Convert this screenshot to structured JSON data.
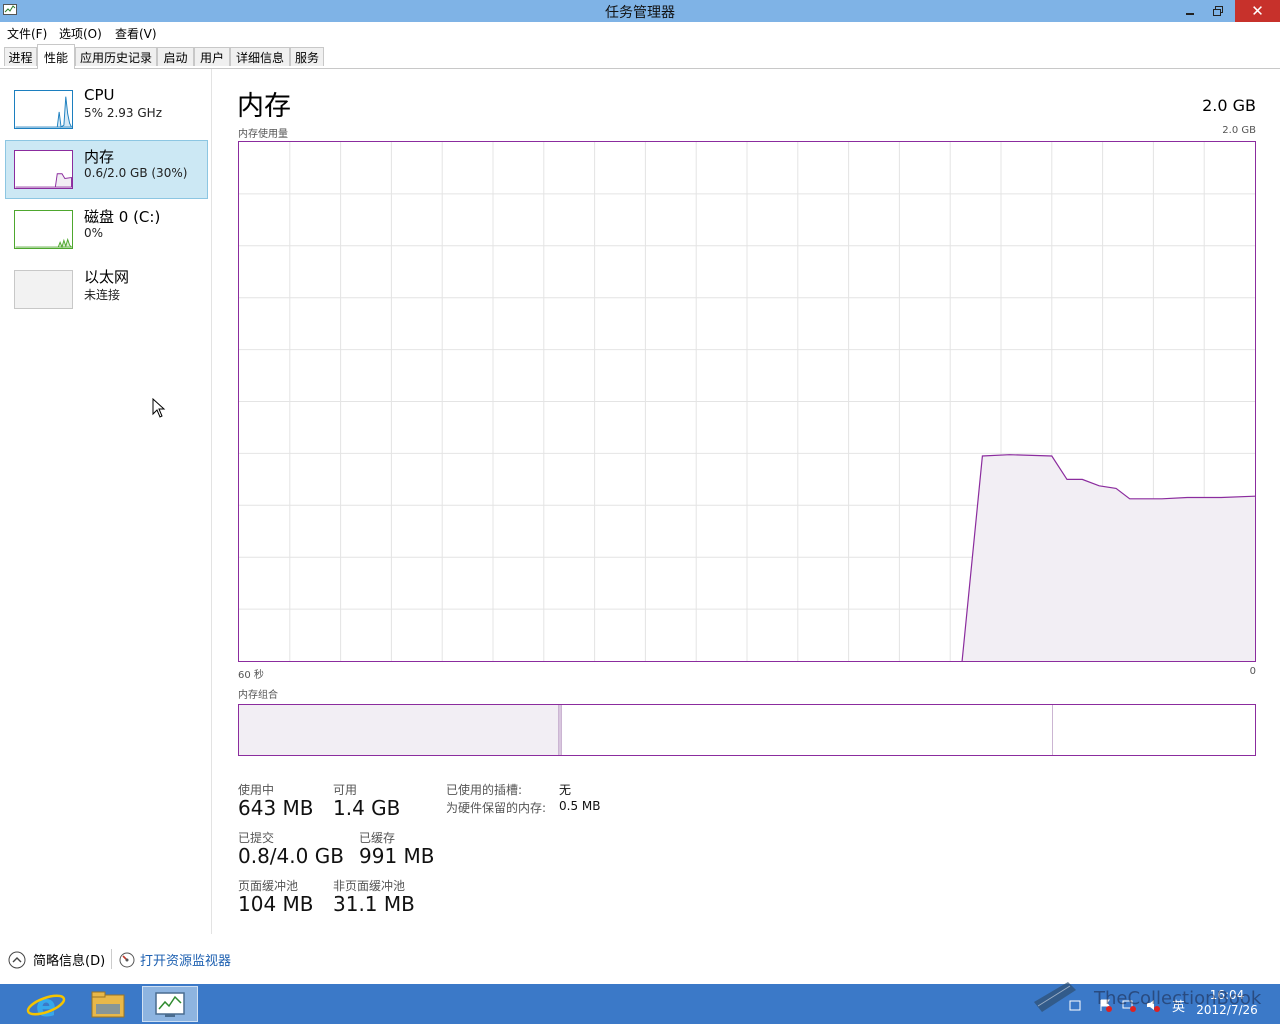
{
  "window": {
    "title": "任务管理器"
  },
  "menu": [
    "文件(F)",
    "选项(O)",
    "查看(V)"
  ],
  "tabs": [
    "进程",
    "性能",
    "应用历史记录",
    "启动",
    "用户",
    "详细信息",
    "服务"
  ],
  "active_tab": "性能",
  "resources": [
    {
      "name": "CPU",
      "sub": "5%  2.93 GHz",
      "color": "#1c7fbf"
    },
    {
      "name": "内存",
      "sub": "0.6/2.0 GB (30%)",
      "color": "#8b2c9e"
    },
    {
      "name": "磁盘 0 (C:)",
      "sub": "0%",
      "color": "#4ea72e"
    },
    {
      "name": "以太网",
      "sub": "未连接",
      "color": "#a0a0a0"
    }
  ],
  "main": {
    "title": "内存",
    "total": "2.0 GB",
    "graph_label": "内存使用量",
    "graph_max": "2.0 GB",
    "x_left": "60 秒",
    "x_right": "0",
    "composition_label": "内存组合"
  },
  "chart_data": {
    "type": "area",
    "title": "内存使用量",
    "xlabel": "",
    "ylabel": "",
    "x_unit": "seconds ago",
    "xlim": [
      60,
      0
    ],
    "ylim": [
      0,
      2.0
    ],
    "y_unit": "GB",
    "grid": true,
    "color": "#8b2c9e",
    "fill": "#f2eef4",
    "points": [
      [
        17.3,
        0.0
      ],
      [
        16.1,
        0.79
      ],
      [
        14.5,
        0.795
      ],
      [
        12.0,
        0.79
      ],
      [
        11.1,
        0.7
      ],
      [
        10.2,
        0.7
      ],
      [
        9.2,
        0.675
      ],
      [
        8.2,
        0.665
      ],
      [
        7.4,
        0.625
      ],
      [
        5.5,
        0.625
      ],
      [
        4.0,
        0.63
      ],
      [
        2.0,
        0.63
      ],
      [
        0,
        0.635
      ]
    ]
  },
  "composition": {
    "segments": [
      {
        "value": 0.63,
        "fill": "#f2eef4"
      },
      {
        "value": 0.005,
        "fill": "#d9c6df"
      },
      {
        "value": 0.97,
        "fill": "#ffffff"
      },
      {
        "value": 0.4,
        "fill": "#ffffff"
      }
    ],
    "color": "#8b2c9e"
  },
  "stats": {
    "in_use_label": "使用中",
    "in_use": "643 MB",
    "available_label": "可用",
    "available": "1.4 GB",
    "committed_label": "已提交",
    "committed": "0.8/4.0 GB",
    "cached_label": "已缓存",
    "cached": "991 MB",
    "paged_label": "页面缓冲池",
    "paged": "104 MB",
    "nonpaged_label": "非页面缓冲池",
    "nonpaged": "31.1 MB",
    "slots_label": "已使用的插槽:",
    "slots": "无",
    "reserved_label": "为硬件保留的内存:",
    "reserved": "0.5 MB"
  },
  "bottom": {
    "fewer_details": "简略信息(D)",
    "open_monitor": "打开资源监视器"
  },
  "taskbar": {
    "time": "16:04",
    "date": "2012/7/26",
    "ime": "英",
    "watermark": "TheCollectionBook"
  }
}
